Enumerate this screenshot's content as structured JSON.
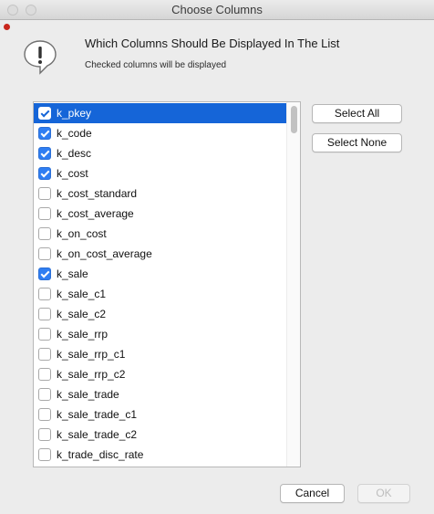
{
  "window": {
    "title": "Choose Columns"
  },
  "header": {
    "heading": "Which Columns Should Be Displayed In The List",
    "subheading": "Checked columns will be displayed"
  },
  "columns": [
    {
      "label": "k_pkey",
      "checked": true,
      "selected": true
    },
    {
      "label": "k_code",
      "checked": true,
      "selected": false
    },
    {
      "label": "k_desc",
      "checked": true,
      "selected": false
    },
    {
      "label": "k_cost",
      "checked": true,
      "selected": false
    },
    {
      "label": "k_cost_standard",
      "checked": false,
      "selected": false
    },
    {
      "label": "k_cost_average",
      "checked": false,
      "selected": false
    },
    {
      "label": "k_on_cost",
      "checked": false,
      "selected": false
    },
    {
      "label": "k_on_cost_average",
      "checked": false,
      "selected": false
    },
    {
      "label": "k_sale",
      "checked": true,
      "selected": false
    },
    {
      "label": "k_sale_c1",
      "checked": false,
      "selected": false
    },
    {
      "label": "k_sale_c2",
      "checked": false,
      "selected": false
    },
    {
      "label": "k_sale_rrp",
      "checked": false,
      "selected": false
    },
    {
      "label": "k_sale_rrp_c1",
      "checked": false,
      "selected": false
    },
    {
      "label": "k_sale_rrp_c2",
      "checked": false,
      "selected": false
    },
    {
      "label": "k_sale_trade",
      "checked": false,
      "selected": false
    },
    {
      "label": "k_sale_trade_c1",
      "checked": false,
      "selected": false
    },
    {
      "label": "k_sale_trade_c2",
      "checked": false,
      "selected": false
    },
    {
      "label": "k_trade_disc_rate",
      "checked": false,
      "selected": false
    }
  ],
  "buttons": {
    "select_all": "Select All",
    "select_none": "Select None",
    "cancel": "Cancel",
    "ok": "OK",
    "ok_enabled": false
  },
  "colors": {
    "selection": "#1565d8",
    "checkbox_checked": "#2f7ef2"
  }
}
